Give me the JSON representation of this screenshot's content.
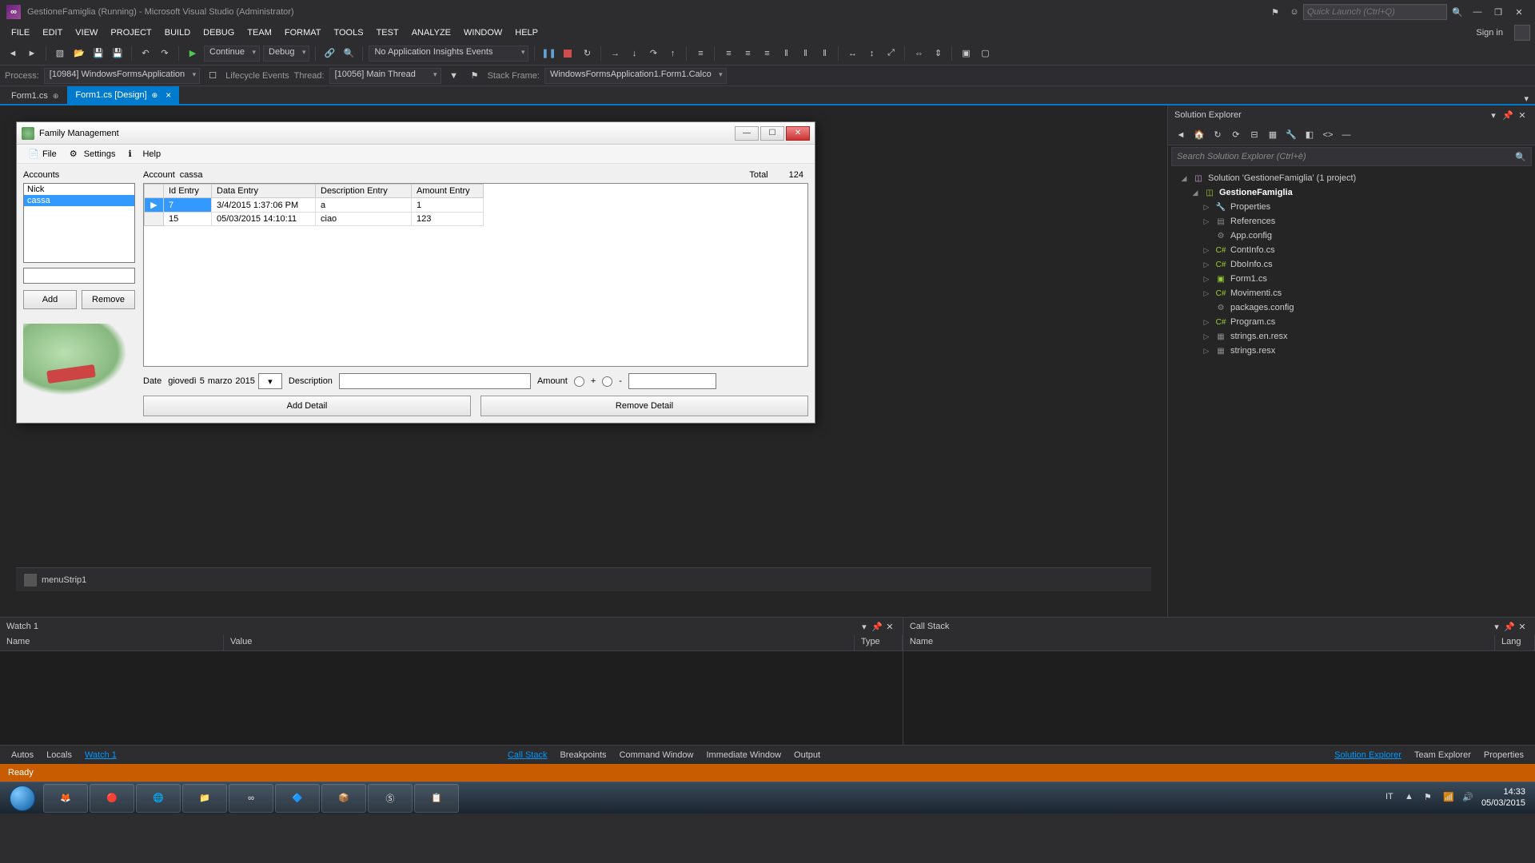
{
  "titlebar": {
    "title": "GestioneFamiglia (Running) - Microsoft Visual Studio (Administrator)",
    "quick_launch_placeholder": "Quick Launch (Ctrl+Q)"
  },
  "menu": {
    "items": [
      "FILE",
      "EDIT",
      "VIEW",
      "PROJECT",
      "BUILD",
      "DEBUG",
      "TEAM",
      "FORMAT",
      "TOOLS",
      "TEST",
      "ANALYZE",
      "WINDOW",
      "HELP"
    ],
    "signin": "Sign in"
  },
  "toolbar": {
    "continue": "Continue",
    "config": "Debug",
    "insights": "No Application Insights Events"
  },
  "debugbar": {
    "process_lbl": "Process:",
    "process_val": "[10984] WindowsFormsApplication",
    "lifecycle": "Lifecycle Events",
    "thread_lbl": "Thread:",
    "thread_val": "[10056] Main Thread",
    "stackframe_lbl": "Stack Frame:",
    "stackframe_val": "WindowsFormsApplication1.Form1.Calco"
  },
  "tabs": [
    {
      "label": "Form1.cs",
      "active": false,
      "pinned": true
    },
    {
      "label": "Form1.cs [Design]",
      "active": true,
      "pinned": true
    }
  ],
  "wf": {
    "title": "Family Management",
    "menu": {
      "file": "File",
      "settings": "Settings",
      "help": "Help"
    },
    "accounts_lbl": "Accounts",
    "list": [
      "Nick",
      "cassa"
    ],
    "add_btn": "Add",
    "remove_btn": "Remove",
    "account_lbl": "Account",
    "account_val": "cassa",
    "total_lbl": "Total",
    "total_val": "124",
    "grid": {
      "cols": [
        "Id Entry",
        "Data Entry",
        "Description Entry",
        "Amount Entry"
      ],
      "rows": [
        {
          "sel": true,
          "id": "7",
          "date": "3/4/2015 1:37:06 PM",
          "desc": "a",
          "amount": "1"
        },
        {
          "sel": false,
          "id": "15",
          "date": "05/03/2015 14:10:11",
          "desc": "ciao",
          "amount": "123"
        }
      ]
    },
    "date_lbl": "Date",
    "date_day": "giovedì",
    "date_num": "5",
    "date_month": "marzo",
    "date_year": "2015",
    "desc_lbl": "Description",
    "amount_lbl": "Amount",
    "plus": "+",
    "minus": "-",
    "add_detail": "Add Detail",
    "remove_detail": "Remove Detail"
  },
  "tray_component": "menuStrip1",
  "sol": {
    "title": "Solution Explorer",
    "search_placeholder": "Search Solution Explorer (Ctrl+è)",
    "solution": "Solution 'GestioneFamiglia' (1 project)",
    "project": "GestioneFamiglia",
    "nodes": [
      "Properties",
      "References",
      "App.config",
      "ContInfo.cs",
      "DboInfo.cs",
      "Form1.cs",
      "Movimenti.cs",
      "packages.config",
      "Program.cs",
      "strings.en.resx",
      "strings.resx"
    ]
  },
  "watch": {
    "title": "Watch 1",
    "cols": [
      "Name",
      "Value",
      "Type"
    ]
  },
  "callstack": {
    "title": "Call Stack",
    "cols": [
      "Name",
      "Lang"
    ]
  },
  "bottabs_left": [
    "Autos",
    "Locals",
    "Watch 1"
  ],
  "bottabs_mid": [
    "Call Stack",
    "Breakpoints",
    "Command Window",
    "Immediate Window",
    "Output"
  ],
  "bottabs_right": [
    "Solution Explorer",
    "Team Explorer",
    "Properties"
  ],
  "status": "Ready",
  "clock": {
    "time": "14:33",
    "date": "05/03/2015"
  }
}
